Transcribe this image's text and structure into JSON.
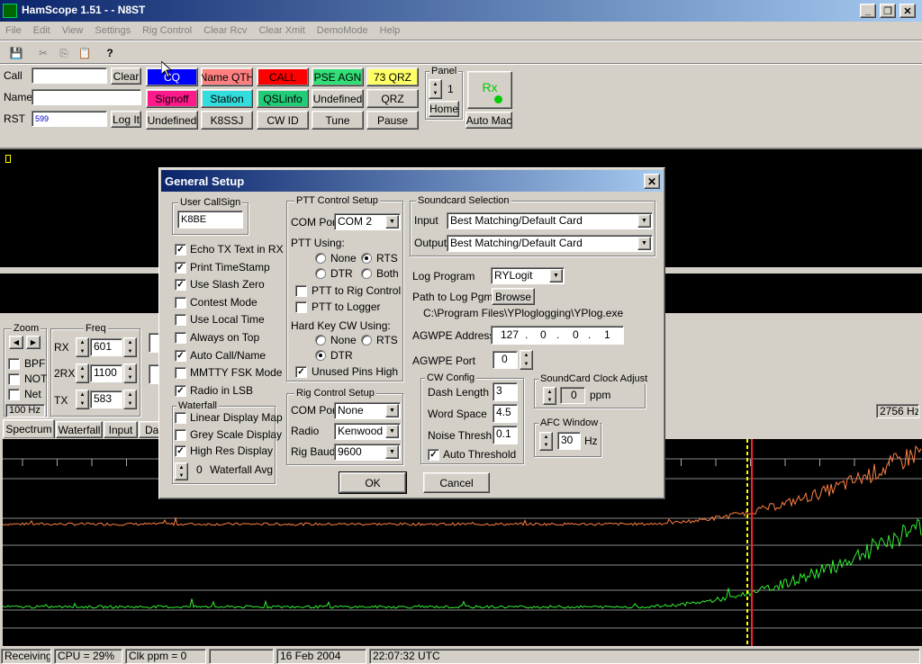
{
  "window": {
    "title": "HamScope 1.51 - - N8ST",
    "controls": [
      "_",
      "❐",
      "✕"
    ]
  },
  "menu": [
    "File",
    "Edit",
    "View",
    "Settings",
    "Rig Control",
    "Clear Rcv",
    "Clear Xmit",
    "DemoMode",
    "Help"
  ],
  "toolbar": {
    "icons": [
      "save-icon",
      "cut-icon",
      "copy-icon",
      "paste-icon",
      "help-icon"
    ],
    "glyphs": [
      "💾",
      "✂",
      "⎘",
      "📋",
      "?"
    ]
  },
  "qso": {
    "call_label": "Call",
    "name_label": "Name",
    "rst_label": "RST",
    "call_value": "",
    "name_value": "",
    "rst_value": "599",
    "clear": "Clear",
    "logit": "Log It"
  },
  "macros": [
    {
      "label": "CQ",
      "bg": "#0000ff",
      "fg": "#ffffff"
    },
    {
      "label": "Name QTH",
      "bg": "#ff8080",
      "fg": "#000000"
    },
    {
      "label": "CALL",
      "bg": "#ff0000",
      "fg": "#000000"
    },
    {
      "label": "PSE AGN",
      "bg": "#33dd77",
      "fg": "#000000"
    },
    {
      "label": "73 QRZ",
      "bg": "#ffff66",
      "fg": "#000000"
    },
    {
      "label": "Signoff",
      "bg": "#ff1a8c",
      "fg": "#000000"
    },
    {
      "label": "Station",
      "bg": "#33dddd",
      "fg": "#000000"
    },
    {
      "label": "QSLinfo",
      "bg": "#22cc77",
      "fg": "#000000"
    },
    {
      "label": "Undefined",
      "bg": "#d4d0c8",
      "fg": "#000000"
    },
    {
      "label": "QRZ",
      "bg": "#d4d0c8",
      "fg": "#000000"
    },
    {
      "label": "Undefined",
      "bg": "#d4d0c8",
      "fg": "#000000"
    },
    {
      "label": "K8SSJ",
      "bg": "#d4d0c8",
      "fg": "#000000"
    },
    {
      "label": "CW ID",
      "bg": "#d4d0c8",
      "fg": "#000000"
    },
    {
      "label": "Tune",
      "bg": "#d4d0c8",
      "fg": "#000000"
    },
    {
      "label": "Pause",
      "bg": "#d4d0c8",
      "fg": "#000000"
    }
  ],
  "panel": {
    "label": "Panel",
    "value": "1",
    "home": "Home",
    "rx": "Rx",
    "automac": "Auto Mac"
  },
  "zoom": {
    "label": "Zoom",
    "bpf": "BPF",
    "not": "NOT",
    "net": "Net",
    "hz": "100 Hz"
  },
  "freq": {
    "label": "Freq",
    "rx_label": "RX",
    "rx": "601",
    "rx2_label": "2RX",
    "rx2": "1100",
    "tx_label": "TX",
    "tx": "583"
  },
  "tabs": [
    "Spectrum",
    "Waterfall",
    "Input",
    "Da"
  ],
  "right_hz": "2756 Hz",
  "dialog": {
    "title": "General Setup",
    "callsign_group": "User CallSign",
    "callsign": "K8BE",
    "checks": [
      {
        "label": "Echo TX Text in RX",
        "checked": true
      },
      {
        "label": "Print TimeStamp",
        "checked": true
      },
      {
        "label": "Use Slash Zero",
        "checked": true
      },
      {
        "label": "Contest Mode",
        "checked": false
      },
      {
        "label": "Use Local Time",
        "checked": false
      },
      {
        "label": "Always on Top",
        "checked": false
      },
      {
        "label": "Auto Call/Name",
        "checked": true
      },
      {
        "label": "MMTTY FSK Mode",
        "checked": false
      },
      {
        "label": "Radio in LSB",
        "checked": true
      }
    ],
    "waterfall": {
      "label": "Waterfall",
      "linear": "Linear Display Map",
      "grey": "Grey Scale Display",
      "highres": "High Res Display",
      "avg_value": "0",
      "avg_label": "Waterfall Avg"
    },
    "ptt": {
      "label": "PTT Control Setup",
      "com_label": "COM Port",
      "com": "COM 2",
      "using": "PTT Using:",
      "none": "None",
      "rts": "RTS",
      "dtr": "DTR",
      "both": "Both",
      "to_rig": "PTT to Rig Control",
      "to_logger": "PTT to Logger"
    },
    "hardkey": {
      "label": "Hard Key CW Using:",
      "none": "None",
      "rts": "RTS",
      "dtr": "DTR",
      "unused": "Unused Pins High"
    },
    "rig": {
      "label": "Rig Control Setup",
      "com_label": "COM Port",
      "com": "None",
      "radio_label": "Radio",
      "radio": "Kenwood",
      "baud_label": "Rig Baud",
      "baud": "9600"
    },
    "sound": {
      "label": "Soundcard Selection",
      "input_label": "Input",
      "input": "Best Matching/Default Card",
      "output_label": "Output",
      "output": "Best Matching/Default Card"
    },
    "log": {
      "program_label": "Log Program",
      "program": "RYLogit",
      "path_label": "Path to Log Pgm",
      "browse": "Browse",
      "path": "C:\\Program Files\\YPloglogging\\YPlog.exe"
    },
    "agwpe": {
      "addr_label": "AGWPE Address",
      "ip": [
        "127",
        ".",
        "0",
        ".",
        "0",
        ".",
        "1"
      ],
      "port_label": "AGWPE Port",
      "port": "0"
    },
    "cw": {
      "label": "CW Config",
      "dash_label": "Dash Length",
      "dash": "3",
      "word_label": "Word Space",
      "word": "4.5",
      "noise_label": "Noise Thresh",
      "noise": "0.1",
      "auto": "Auto Threshold"
    },
    "clock": {
      "label": "SoundCard Clock Adjust",
      "value": "0",
      "unit": "ppm"
    },
    "afc": {
      "label": "AFC Window",
      "value": "30",
      "unit": "Hz"
    },
    "ok": "OK",
    "cancel": "Cancel"
  },
  "status": {
    "state": "Receiving",
    "cpu": "CPU = 29%",
    "clk": "Clk ppm = 0",
    "blank": "",
    "date": "16 Feb 2004",
    "time": "22:07:32 UTC"
  }
}
